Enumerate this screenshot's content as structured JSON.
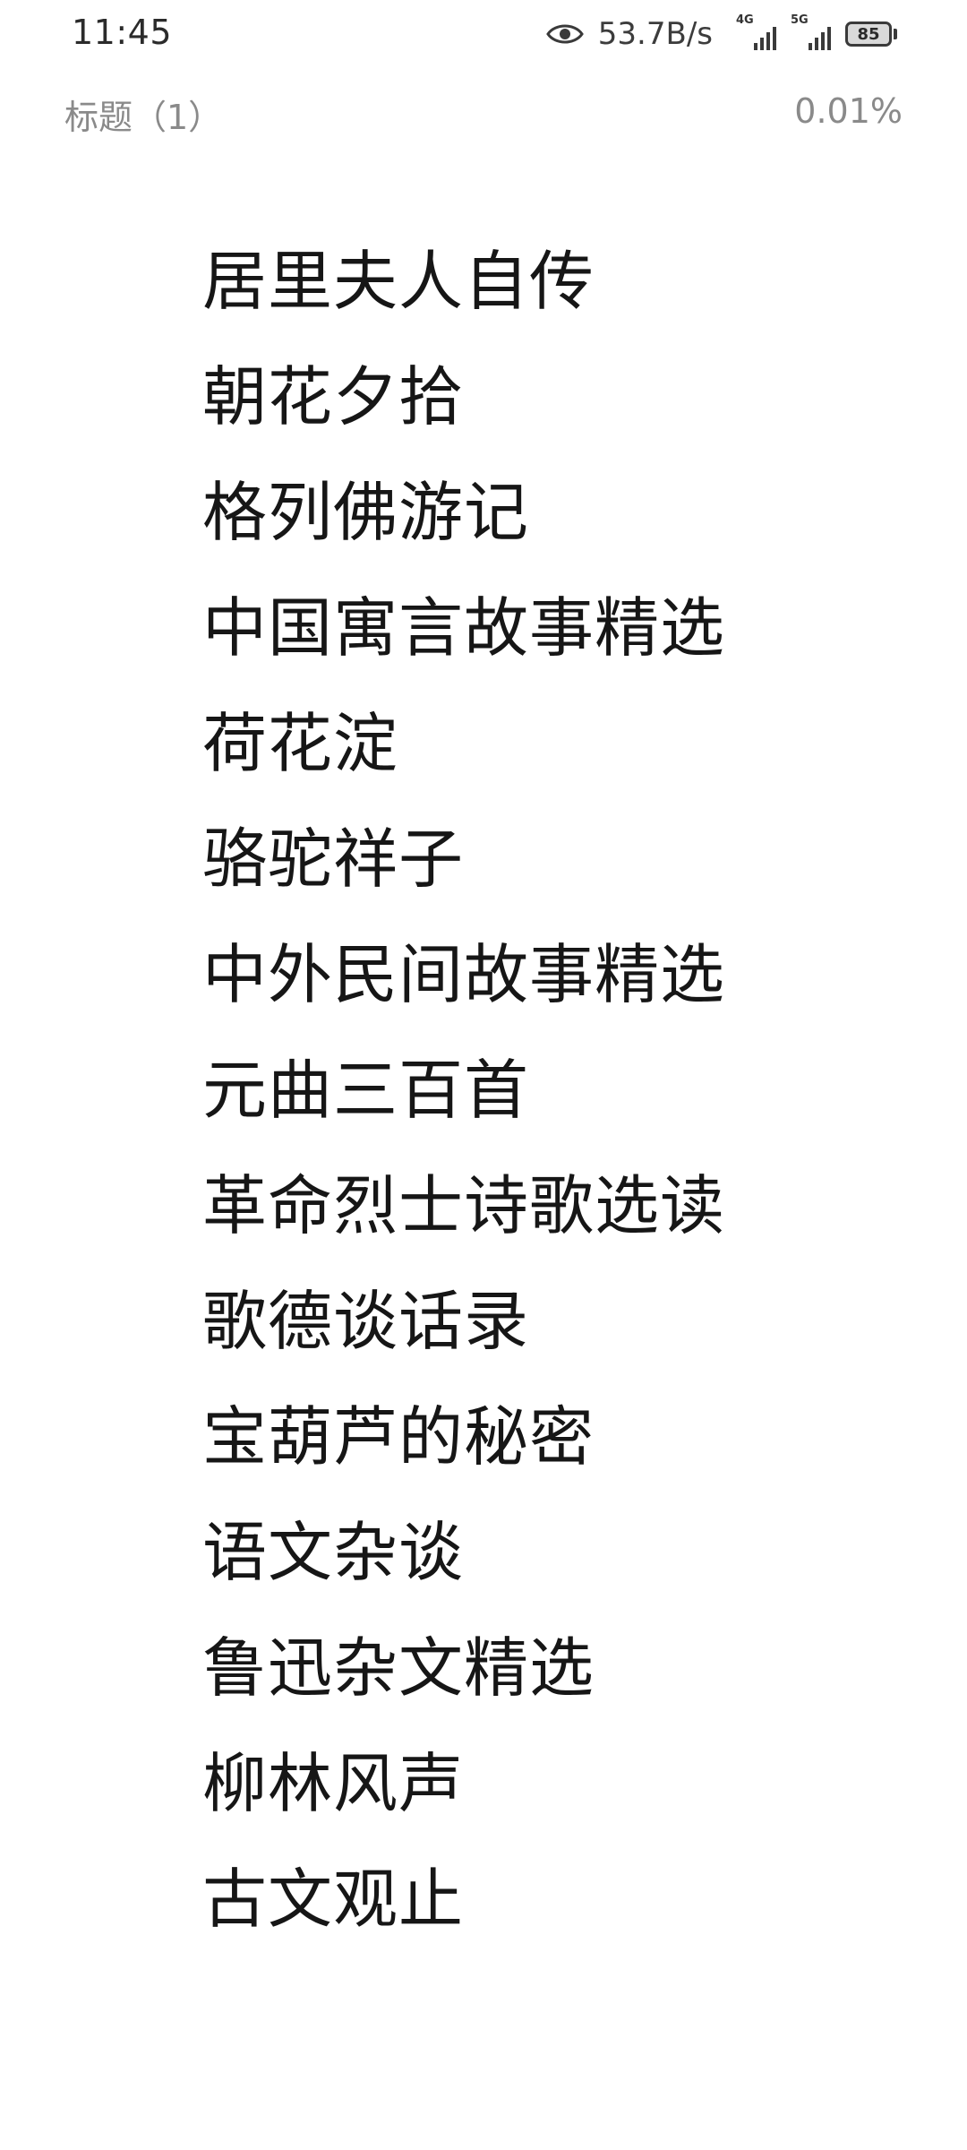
{
  "status_bar": {
    "time": "11:45",
    "net_speed": "53.7B/s",
    "sim1_tag": "4G",
    "sim2_tag": "5G",
    "battery_level": "85",
    "icons": [
      "eye-icon",
      "signal-4g-icon",
      "signal-5g-icon",
      "battery-icon"
    ]
  },
  "reader": {
    "chapter_title": "标题（1）",
    "progress": "0.01%"
  },
  "books": [
    "居里夫人自传",
    "朝花夕拾",
    "格列佛游记",
    "中国寓言故事精选",
    "荷花淀",
    "骆驼祥子",
    "中外民间故事精选",
    "元曲三百首",
    "革命烈士诗歌选读",
    "歌德谈话录",
    "宝葫芦的秘密",
    "语文杂谈",
    "鲁迅杂文精选",
    "柳林风声",
    "古文观止"
  ]
}
